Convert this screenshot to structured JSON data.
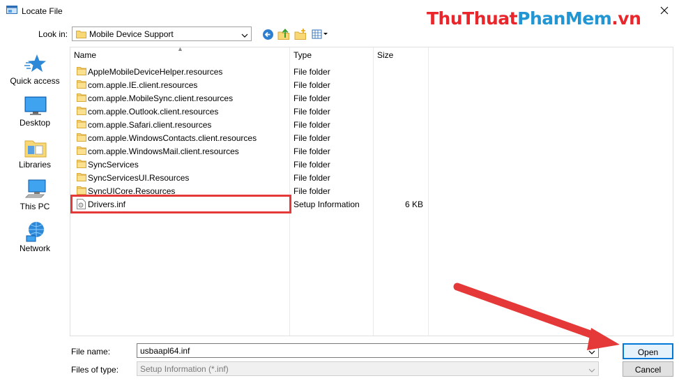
{
  "window": {
    "title": "Locate File",
    "icons": {
      "app": "locate-file-app-icon",
      "close": "close-icon"
    }
  },
  "watermark": {
    "part1": "ThuThuat",
    "part2": "PhanMem",
    "part3": ".vn"
  },
  "toolbar": {
    "look_in_label": "Look in:",
    "look_in_value": "Mobile Device Support",
    "icons": [
      "back-arrow-icon",
      "up-folder-icon",
      "new-folder-icon",
      "view-menu-icon"
    ]
  },
  "places": [
    {
      "label": "Quick access",
      "icon": "quick-access-star-icon"
    },
    {
      "label": "Desktop",
      "icon": "desktop-icon"
    },
    {
      "label": "Libraries",
      "icon": "libraries-icon"
    },
    {
      "label": "This PC",
      "icon": "this-pc-icon"
    },
    {
      "label": "Network",
      "icon": "network-icon"
    }
  ],
  "columns": {
    "name": "Name",
    "type": "Type",
    "size": "Size"
  },
  "files": [
    {
      "name": "AppleMobileDeviceHelper.resources",
      "type": "File folder",
      "size": "",
      "icon": "folder-icon"
    },
    {
      "name": "com.apple.IE.client.resources",
      "type": "File folder",
      "size": "",
      "icon": "folder-icon"
    },
    {
      "name": "com.apple.MobileSync.client.resources",
      "type": "File folder",
      "size": "",
      "icon": "folder-icon"
    },
    {
      "name": "com.apple.Outlook.client.resources",
      "type": "File folder",
      "size": "",
      "icon": "folder-icon"
    },
    {
      "name": "com.apple.Safari.client.resources",
      "type": "File folder",
      "size": "",
      "icon": "folder-icon"
    },
    {
      "name": "com.apple.WindowsContacts.client.resources",
      "type": "File folder",
      "size": "",
      "icon": "folder-icon"
    },
    {
      "name": "com.apple.WindowsMail.client.resources",
      "type": "File folder",
      "size": "",
      "icon": "folder-icon"
    },
    {
      "name": "SyncServices",
      "type": "File folder",
      "size": "",
      "icon": "folder-icon"
    },
    {
      "name": "SyncServicesUI.Resources",
      "type": "File folder",
      "size": "",
      "icon": "folder-icon"
    },
    {
      "name": "SyncUICore.Resources",
      "type": "File folder",
      "size": "",
      "icon": "folder-icon"
    },
    {
      "name": "Drivers.inf",
      "type": "Setup Information",
      "size": "6 KB",
      "icon": "setup-information-file-icon"
    }
  ],
  "footer": {
    "file_name_label": "File name:",
    "file_name_value": "usbaapl64.inf",
    "file_type_label": "Files of type:",
    "file_type_value": "Setup Information (*.inf)",
    "open_label": "Open",
    "cancel_label": "Cancel"
  },
  "colors": {
    "annotation_red": "#e53838",
    "accent_blue": "#0078d7",
    "folder_yellow": "#f8d775"
  }
}
